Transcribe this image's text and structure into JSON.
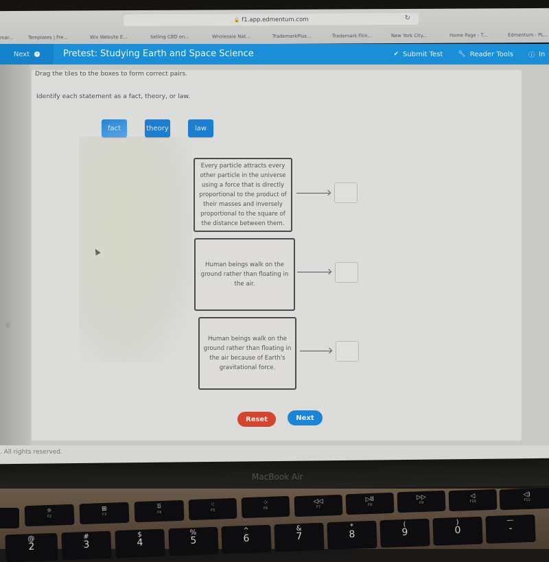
{
  "browser": {
    "url": "f1.app.edmentum.com",
    "bookmarks": [
      "mar...",
      "Templates | Fre...",
      "Wix Website E...",
      "Selling CBD on...",
      "Wholesale Nat...",
      "TrademarkPlus...",
      "Trademark Filin...",
      "New York City...",
      "Home Page - T...",
      "Edmentum - PL..."
    ]
  },
  "header": {
    "next_label": "Next",
    "title": "Pretest: Studying Earth and Space Science",
    "submit_label": "Submit Test",
    "reader_tools_label": "Reader Tools",
    "info_label": "In"
  },
  "question": {
    "instruction": "Drag the tiles to the boxes to form correct pairs.",
    "prompt": "Identify each statement as a fact, theory, or law.",
    "tiles": [
      "fact",
      "theory",
      "law"
    ],
    "statements": [
      "Every particle attracts every other particle in the universe using a force that is directly proportional to the product of their masses and inversely proportional to the square of the distance between them.",
      "Human beings walk on the ground rather than floating in the air.",
      "Human beings walk on the ground rather than floating in the air because of Earth's gravitational force."
    ],
    "answers": [
      "",
      "",
      ""
    ]
  },
  "actions": {
    "reset_label": "Reset",
    "next_label": "Next"
  },
  "footer": {
    "text": ". All rights reserved."
  },
  "device": {
    "brand": "MacBook Air"
  },
  "keyboard": {
    "fn_keys": [
      {
        "sym": "☼",
        "label": "F2"
      },
      {
        "sym": "⊞",
        "label": "F3"
      },
      {
        "sym": "⠿",
        "label": "F4"
      },
      {
        "sym": "⁖",
        "label": "F5"
      },
      {
        "sym": "⁘",
        "label": "F6"
      },
      {
        "sym": "◁◁",
        "label": "F7"
      },
      {
        "sym": "▷II",
        "label": "F8"
      },
      {
        "sym": "▷▷",
        "label": "F9"
      },
      {
        "sym": "◁",
        "label": "F10"
      },
      {
        "sym": "◁)",
        "label": "F11"
      }
    ],
    "num_keys": [
      {
        "sym": "@",
        "digit": "2"
      },
      {
        "sym": "#",
        "digit": "3"
      },
      {
        "sym": "$",
        "digit": "4"
      },
      {
        "sym": "%",
        "digit": "5"
      },
      {
        "sym": "^",
        "digit": "6"
      },
      {
        "sym": "&",
        "digit": "7"
      },
      {
        "sym": "*",
        "digit": "8"
      },
      {
        "sym": "(",
        "digit": "9"
      },
      {
        "sym": ")",
        "digit": "0"
      },
      {
        "sym": "—",
        "digit": "-"
      }
    ]
  },
  "colors": {
    "header_blue": "#1a8ed6",
    "tile_blue": "#1d7dd1",
    "reset_red": "#d3452c",
    "next_blue": "#1a84d6"
  }
}
